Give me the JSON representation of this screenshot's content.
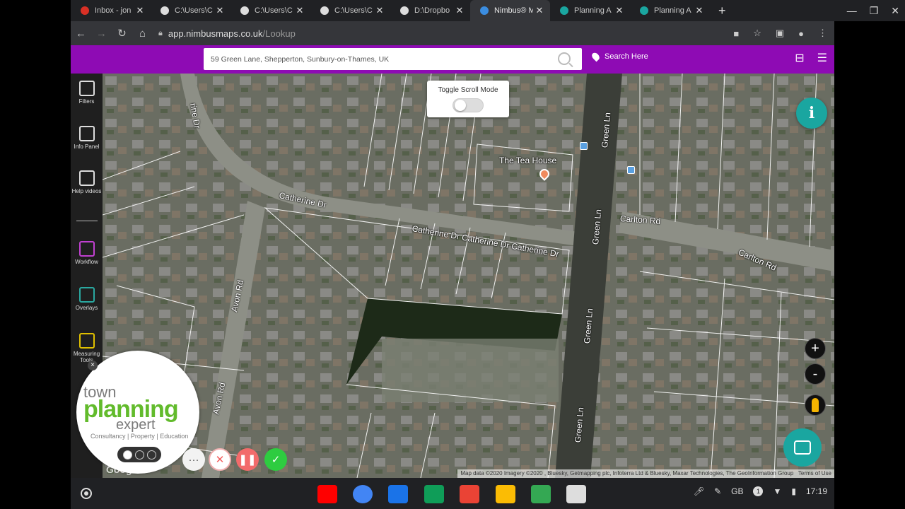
{
  "browser": {
    "tabs": [
      {
        "label": "Inbox - jon",
        "favicon_color": "#d93025"
      },
      {
        "label": "C:\\Users\\C",
        "favicon_color": "#dddddd"
      },
      {
        "label": "C:\\Users\\C",
        "favicon_color": "#dddddd"
      },
      {
        "label": "C:\\Users\\C",
        "favicon_color": "#dddddd"
      },
      {
        "label": "D:\\Dropbo",
        "favicon_color": "#dddddd"
      },
      {
        "label": "Nimbus® M",
        "favicon_color": "#3b8de0"
      },
      {
        "label": "Planning A",
        "favicon_color": "#1aa6a0"
      },
      {
        "label": "Planning A",
        "favicon_color": "#1aa6a0"
      }
    ],
    "active_tab_index": 5,
    "new_tab": "+",
    "window_controls": {
      "minimize": "—",
      "maximize": "❐",
      "close": "✕"
    },
    "url_domain": "app.nimbusmaps.co.uk",
    "url_path": "/Lookup"
  },
  "app": {
    "search_value": "59 Green Lane, Shepperton, Sunbury-on-Thames, UK",
    "search_here_label": "Search Here",
    "accent_color": "#8e0bb4",
    "tools": [
      {
        "label": "Filters",
        "icon": "sliders-icon"
      },
      {
        "label": "Info Panel",
        "icon": "info-panel-icon"
      },
      {
        "label": "Help videos",
        "icon": "video-icon"
      },
      {
        "label": "Workflow",
        "icon": "workflow-icon"
      },
      {
        "label": "Overlays",
        "icon": "layers-icon"
      },
      {
        "label": "Measuring Tools",
        "icon": "measure-icon"
      }
    ],
    "toggle_scroll_label": "Toggle Scroll Mode",
    "toggle_scroll_on": false,
    "zoom_in": "+",
    "zoom_out": "-",
    "info_glyph": "i"
  },
  "map": {
    "labels": [
      {
        "text": "Catherine Dr",
        "id": "catherine-dr-1"
      },
      {
        "text": "Catherine Dr Catherine Dr Catherine Dr",
        "id": "catherine-dr-2"
      },
      {
        "text": "Avon Rd",
        "id": "avon-rd-1"
      },
      {
        "text": "Avon Rd",
        "id": "avon-rd-2"
      },
      {
        "text": "Green Ln",
        "id": "green-ln-1"
      },
      {
        "text": "Green Ln",
        "id": "green-ln-2"
      },
      {
        "text": "Green Ln",
        "id": "green-ln-3"
      },
      {
        "text": "Green Ln",
        "id": "green-ln-4"
      },
      {
        "text": "Carlton Rd",
        "id": "carlton-rd-1"
      },
      {
        "text": "Carlton Rd",
        "id": "carlton-rd-2"
      },
      {
        "text": "rine Dr",
        "id": "rine-dr"
      },
      {
        "text": "The Tea House",
        "id": "tea-house"
      }
    ],
    "attribution": "Map data ©2020 Imagery ©2020 , Bluesky, Getmapping plc, Infoterra Ltd & Bluesky, Maxar Technologies, The GeoInformation Group",
    "terms": "Terms of Use",
    "google_logo": "Google"
  },
  "overlay": {
    "brand_line1": "town",
    "brand_line2": "planning",
    "brand_line3": "expert",
    "brand_tagline": "Consultancy | Property | Education",
    "brand_green": "#62bb2c",
    "recorder_buttons": [
      {
        "glyph": "···",
        "color": "#555555"
      },
      {
        "glyph": "✕",
        "color": "#ffffff"
      },
      {
        "glyph": "❚❚",
        "color": "#ffffff"
      },
      {
        "glyph": "✓",
        "color": "#2ecc40"
      }
    ]
  },
  "shelf": {
    "apps": [
      {
        "name": "youtube-icon",
        "color": "#ff0000"
      },
      {
        "name": "chrome-icon",
        "color": "#4285f4"
      },
      {
        "name": "files-icon",
        "color": "#1a73e8"
      },
      {
        "name": "drive-icon",
        "color": "#0f9d58"
      },
      {
        "name": "gmail-icon",
        "color": "#ea4335"
      },
      {
        "name": "docs-icon",
        "color": "#fbbc04"
      },
      {
        "name": "play-store-icon",
        "color": "#34a853"
      },
      {
        "name": "tablet-icon",
        "color": "#dddddd"
      }
    ],
    "keyboard_layout": "GB",
    "notification_count": "1",
    "time": "17:19"
  }
}
